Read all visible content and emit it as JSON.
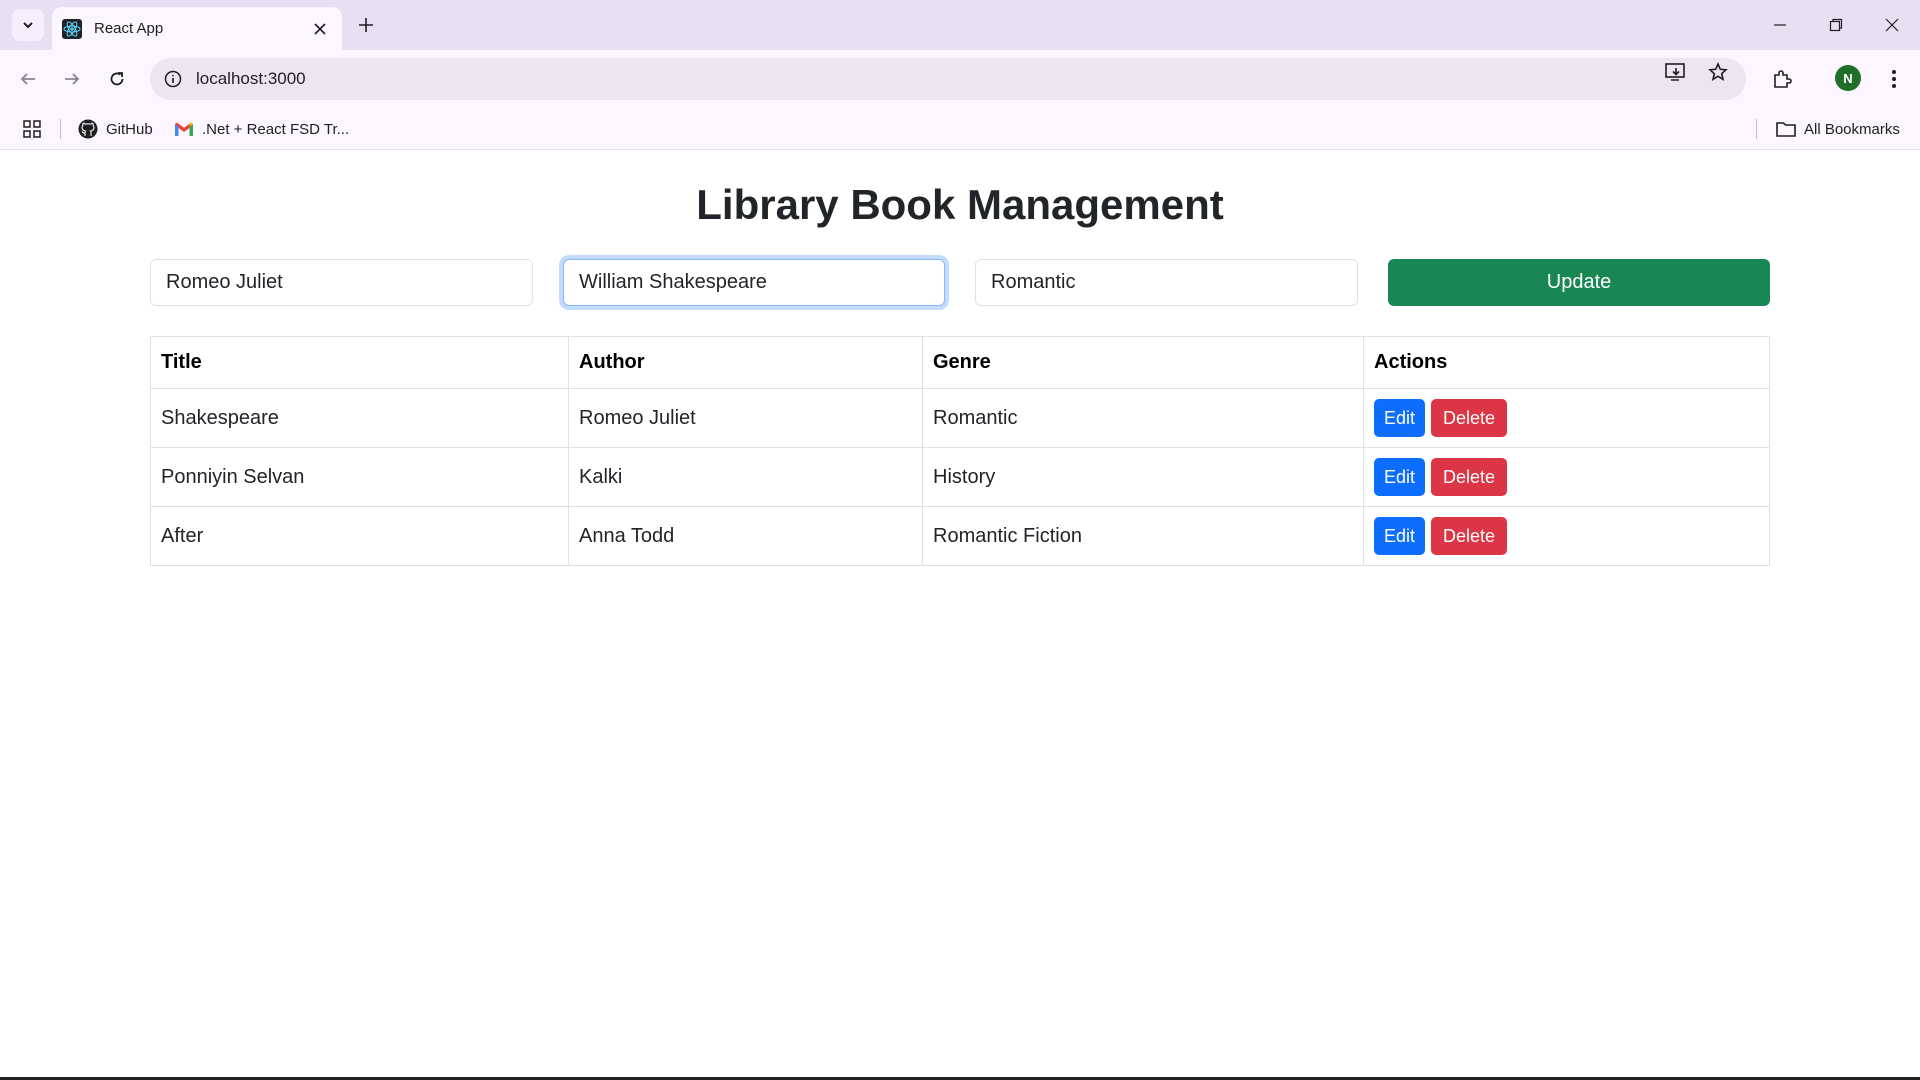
{
  "browser": {
    "tab_title": "React App",
    "url": "localhost:3000",
    "bookmarks": [
      {
        "label": "GitHub",
        "icon": "github-icon"
      },
      {
        "label": ".Net + React FSD Tr...",
        "icon": "gmail-icon"
      }
    ],
    "all_bookmarks_label": "All Bookmarks",
    "avatar_initial": "N"
  },
  "page": {
    "title": "Library Book Management",
    "form": {
      "title_value": "Romeo Juliet",
      "author_value": "William Shakespeare",
      "genre_value": "Romantic",
      "submit_label": "Update"
    },
    "table": {
      "headers": [
        "Title",
        "Author",
        "Genre",
        "Actions"
      ],
      "rows": [
        {
          "title": "Shakespeare",
          "author": "Romeo Juliet",
          "genre": "Romantic"
        },
        {
          "title": "Ponniyin Selvan",
          "author": "Kalki",
          "genre": "History"
        },
        {
          "title": "After",
          "author": "Anna Todd",
          "genre": "Romantic Fiction"
        }
      ],
      "edit_label": "Edit",
      "delete_label": "Delete"
    }
  },
  "colors": {
    "update": "#198754",
    "edit": "#0d6efd",
    "delete": "#dc3545"
  }
}
